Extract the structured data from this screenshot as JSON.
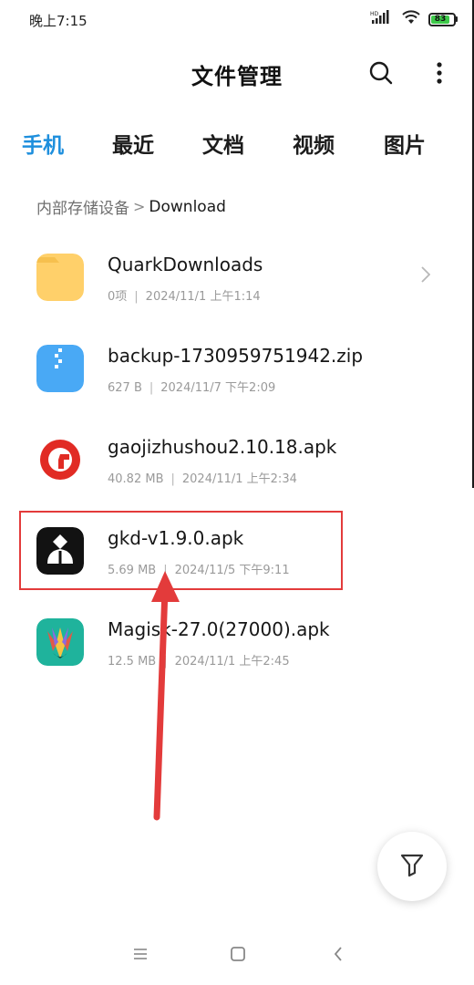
{
  "status_bar": {
    "time": "晚上7:15",
    "hd_label": "HD",
    "battery": "83",
    "battery_level": 0.83,
    "battery_color": "#3ec94a"
  },
  "header": {
    "title": "文件管理",
    "search_icon": "search-icon",
    "more_icon": "more-vertical-icon"
  },
  "tabs": [
    {
      "label": "手机",
      "active": true
    },
    {
      "label": "最近",
      "active": false
    },
    {
      "label": "文档",
      "active": false
    },
    {
      "label": "视频",
      "active": false
    },
    {
      "label": "图片",
      "active": false
    }
  ],
  "accent_color": "#1e8fdd",
  "breadcrumb": {
    "root": "内部存储设备",
    "separator": ">",
    "current": "Download"
  },
  "files": [
    {
      "name": "QuarkDownloads",
      "size": "0项",
      "date": "2024/11/1 上午1:14",
      "icon": "folder-icon"
    },
    {
      "name": "backup-1730959751942.zip",
      "size": "627 B",
      "date": "2024/11/7 下午2:09",
      "icon": "zip-icon"
    },
    {
      "name": "gaojizhushou2.10.18.apk",
      "size": "40.82 MB",
      "date": "2024/11/1 上午2:34",
      "icon": "gaoji-app-icon"
    },
    {
      "name": "gkd-v1.9.0.apk",
      "size": "5.69 MB",
      "date": "2024/11/5 下午9:11",
      "icon": "gkd-app-icon"
    },
    {
      "name": "Magisk-27.0(27000).apk",
      "size": "12.5 MB",
      "date": "2024/11/1 上午2:45",
      "icon": "magisk-app-icon"
    }
  ],
  "annotation_color": "#e33b3b",
  "fab": {
    "icon": "filter-icon"
  },
  "nav_bar": {
    "menu_icon": "menu-icon",
    "home_icon": "home-icon",
    "back_icon": "back-icon"
  }
}
